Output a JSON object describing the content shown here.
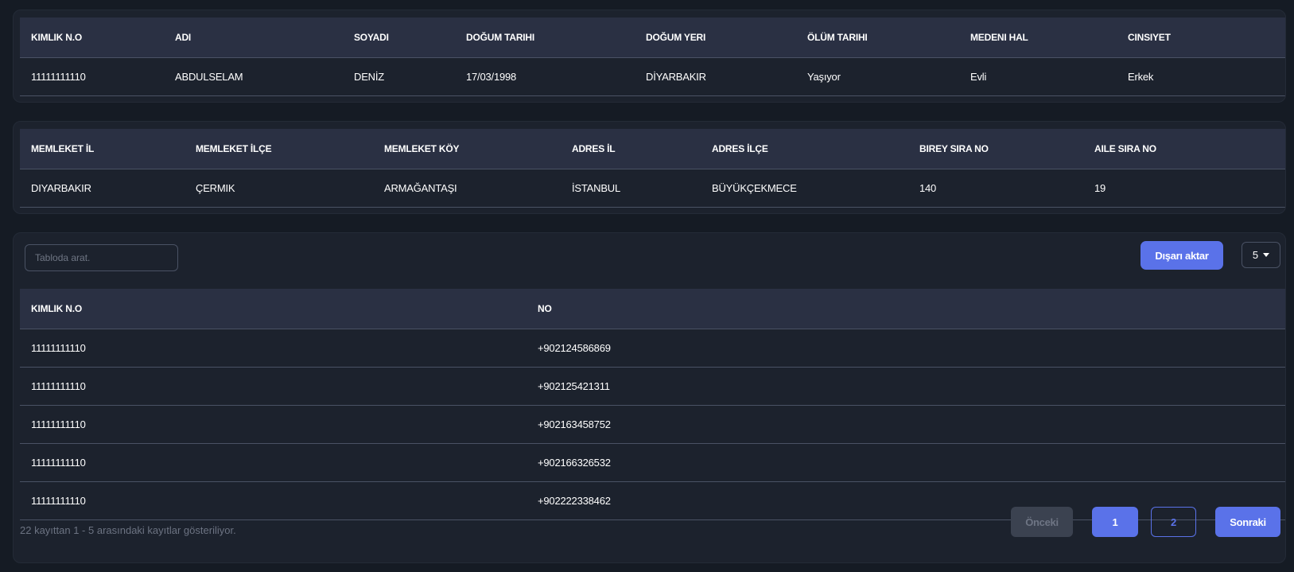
{
  "person": {
    "headers": [
      "KIMLIK N.O",
      "ADI",
      "SOYADI",
      "DOĞUM TARIHI",
      "DOĞUM YERI",
      "ÖLÜM TARIHI",
      "MEDENI HAL",
      "CINSIYET"
    ],
    "row": [
      "11111111110",
      "ABDULSELAM",
      "DENİZ",
      "17/03/1998",
      "DİYARBAKIR",
      "Yaşıyor",
      "Evli",
      "Erkek"
    ]
  },
  "address": {
    "headers": [
      "MEMLEKET İL",
      "MEMLEKET İLÇE",
      "MEMLEKET KÖY",
      "ADRES İL",
      "ADRES İLÇE",
      "BIREY SIRA NO",
      "AILE SIRA NO"
    ],
    "row": [
      "DIYARBAKIR",
      "ÇERMIK",
      "ARMAĞANTAŞI",
      "İSTANBUL",
      "BÜYÜKÇEKMECE",
      "140",
      "19"
    ]
  },
  "phones": {
    "search_placeholder": "Tabloda arat.",
    "export_label": "Dışarı aktar",
    "page_size": "5",
    "headers": [
      "KIMLIK N.O",
      "NO"
    ],
    "rows": [
      [
        "11111111110",
        "+902124586869"
      ],
      [
        "11111111110",
        "+902125421311"
      ],
      [
        "11111111110",
        "+902163458752"
      ],
      [
        "11111111110",
        "+902166326532"
      ],
      [
        "11111111110",
        "+902222338462"
      ]
    ],
    "footer_info": "22 kayıttan 1 - 5 arasındaki kayıtlar gösteriliyor.",
    "pagination": {
      "prev": "Önceki",
      "pages": [
        "1",
        "2"
      ],
      "next": "Sonraki"
    }
  },
  "colors": {
    "background": "#151b24",
    "card": "#1c222d",
    "header_row": "#2a3043",
    "accent": "#5a72e9",
    "muted_text": "#6c7382"
  }
}
